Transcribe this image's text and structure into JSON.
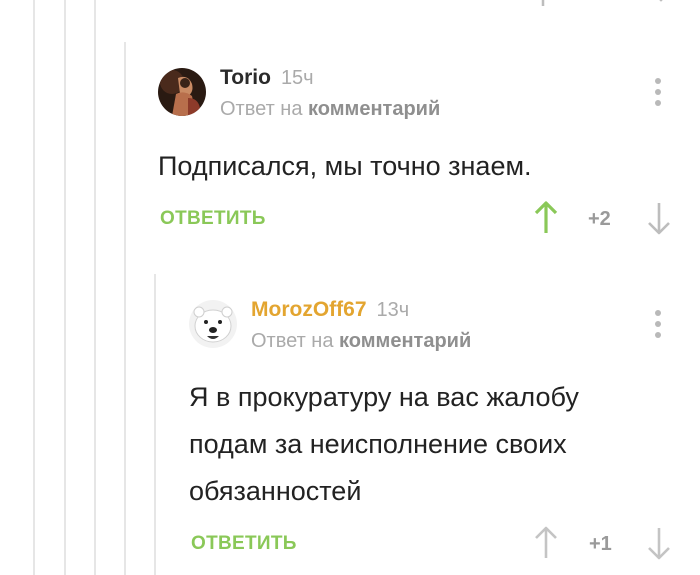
{
  "comments": [
    {
      "author": "Torio",
      "time": "15ч",
      "reply_prefix": "Ответ на",
      "reply_link": "комментарий",
      "text": "Подписался, мы точно знаем.",
      "reply_button": "ОТВЕТИТЬ",
      "score": "+2",
      "voted_up": true
    },
    {
      "author": "MorozOff67",
      "time": "13ч",
      "reply_prefix": "Ответ на",
      "reply_link": "комментарий",
      "text_lines": [
        "Я в прокуратуру на вас жалобу",
        "подам за неисполнение своих",
        "обязанностей"
      ],
      "reply_button": "ОТВЕТИТЬ",
      "score": "+1",
      "voted_up": false
    }
  ],
  "colors": {
    "accent_green": "#8ac858",
    "author_orange": "#e3a530",
    "muted_gray": "#aaaaaa"
  }
}
